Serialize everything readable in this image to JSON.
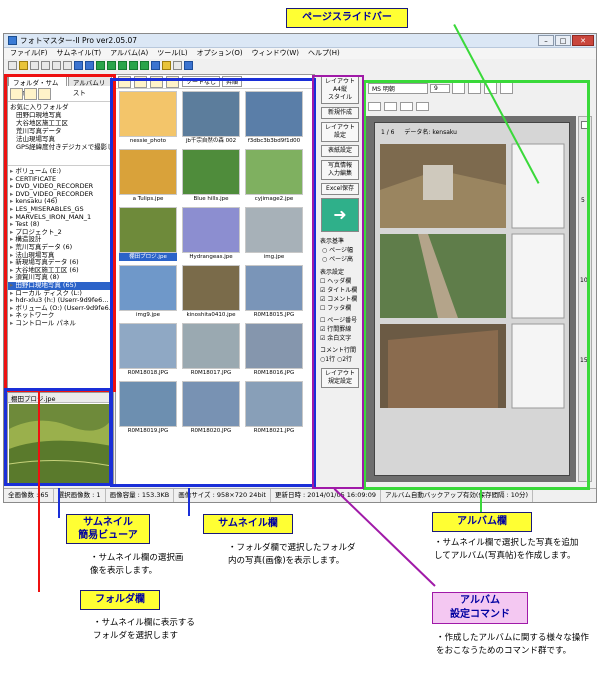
{
  "window": {
    "title": "フォトマスター-II Pro ver2.05.07"
  },
  "menu": [
    "ファイル(F)",
    "サムネイル(T)",
    "アルバム(A)",
    "ツール(L)",
    "オプション(O)",
    "ウィンドウ(W)",
    "ヘルプ(H)"
  ],
  "folder_panel": {
    "tabs": [
      "フォルダ・サムネイル",
      "アルバムリスト"
    ],
    "favorites_header": "お気に入りフォルダ",
    "favorites": [
      "田野口現地写真",
      "大谷地区施工工区",
      "荒川写真データ",
      "法山現場写真",
      "GPS経緯度付きデジカメで撮影した位置"
    ],
    "tree": [
      "ボリューム (E:)",
      "CERTIFICATE",
      "DVD_VIDEO_RECORDER",
      "DVD_VIDEO_RECORDER",
      "kensaku (46)",
      "LES_MISERABLES_GS",
      "MARVELS_IRON_MAN_1",
      "Test (8)",
      "プロジェクト_2",
      "構造設計",
      "荒川写真データ (6)",
      "法山現場写真",
      "新現場写真データ (6)",
      "大谷地区施工工区 (6)",
      "須賀川写真 (8)",
      "田野口現地写真 (65)",
      "ローカル ディスク (L:)",
      "hdr-xlu3 (h:) (Userr-9d9fe6...",
      "ボリューム (O:) (Userr-9d9fe6...",
      "ネットワーク",
      "コントロール パネル"
    ]
  },
  "viewer": {
    "filename": "棚田プロジ.jpe"
  },
  "thumbnail_panel": {
    "sort_label": "ソートなし",
    "order_label": "昇順",
    "items": [
      {
        "name": "nessie_photo",
        "color": "#f3c56a"
      },
      {
        "name": "jb千宗自然の森 002",
        "color": "#5c7d9c"
      },
      {
        "name": "f3dbc3b3bd9f1d00",
        "color": "#5a7ea8"
      },
      {
        "name": "a Tulips.jpe",
        "color": "#d9a23a"
      },
      {
        "name": "Blue hills.jpe",
        "color": "#4f8c3b"
      },
      {
        "name": "cyjimage2.jpe",
        "color": "#7fb060"
      },
      {
        "name": "棚田プロジ.jpe",
        "color": "#6e8a3a"
      },
      {
        "name": "Hydrangeas.jpe",
        "color": "#8c8ed0"
      },
      {
        "name": "img.jpe",
        "color": "#a7b1b8"
      },
      {
        "name": "img9.jpe",
        "color": "#6f98c9"
      },
      {
        "name": "kinoshita0410.jpe",
        "color": "#7a6b4a"
      },
      {
        "name": "R0M18015.JPG",
        "color": "#7a95b8"
      },
      {
        "name": "R0M18018.JPG",
        "color": "#8fa8c4"
      },
      {
        "name": "R0M18017.JPG",
        "color": "#9aa9b1"
      },
      {
        "name": "R0M18016.JPG",
        "color": "#8596ad"
      },
      {
        "name": "R0M18019.JPG",
        "color": "#6d8fb0"
      },
      {
        "name": "R0M18020.JPG",
        "color": "#7892b3"
      },
      {
        "name": "R0M18021.JPG",
        "color": "#889fb8"
      }
    ]
  },
  "commands": {
    "layout": "レイアウト\nA4縦\nスタイル",
    "new": "新規作成",
    "layout_settings": "レイアウト\n設定",
    "cover": "表紙設定",
    "photo_info": "写真情報\n入力編集",
    "excel": "Excel保存",
    "album_execute": "アルバム作成",
    "display_basis": "表示基準",
    "page_width": "ページ幅",
    "page_height": "ページ高",
    "display_settings": "表示設定",
    "header": "ヘッダ欄",
    "title": "タイトル欄",
    "comment": "コメント欄",
    "footer": "フッタ欄",
    "page_number": "ページ番号",
    "row_lines": "行間罫線",
    "white_text": "余白文字",
    "comment_lines": "コメント行間",
    "line_1": "1行",
    "line_2": "2行",
    "layout_edit": "レイアウト\n規定設定"
  },
  "album_panel": {
    "font_label": "MS 明朝",
    "font_size": "9",
    "page_indicator": "1 / 6",
    "data_name_label": "データ名: kensaku",
    "page_ticks": [
      "5",
      "10",
      "15"
    ]
  },
  "status": {
    "total": "全画像数 : 65",
    "selected": "選択画像数 : 1",
    "volume": "画像容量 : 153.3KB",
    "size": "画像サイズ : 958×720 24bit",
    "updated": "更新日時 : 2014/01/05 16:09:09",
    "autosave": "アルバム自動バックアップ有効(保存間隔 : 10分)"
  },
  "callouts": {
    "page_slider": "ページスライドバー",
    "album": "アルバム欄",
    "album_note": "・サムネイル欄で選択した写真を追加してアルバム(写真帖)を作成します。",
    "thumb_viewer": "サムネイル\n簡易ビューア",
    "thumb_viewer_note": "・サムネイル欄の選択画像を表示します。",
    "thumbnail": "サムネイル欄",
    "thumbnail_note": "・フォルダ欄で選択したフォルダ内の写真(画像)を表示します。",
    "folder": "フォルダ欄",
    "folder_note": "・サムネイル欄に表示するフォルダを選択します",
    "album_cmd": "アルバム\n設定コマンド",
    "album_cmd_note": "・作成したアルバムに関する様々な操作をおこなうためのコマンド群です。"
  },
  "colors": {
    "folder": "#e11111",
    "thumbnail": "#1a2fd8",
    "album": "#3ad93a",
    "command": "#a01aa8",
    "callout_bg": "#ffff33"
  }
}
